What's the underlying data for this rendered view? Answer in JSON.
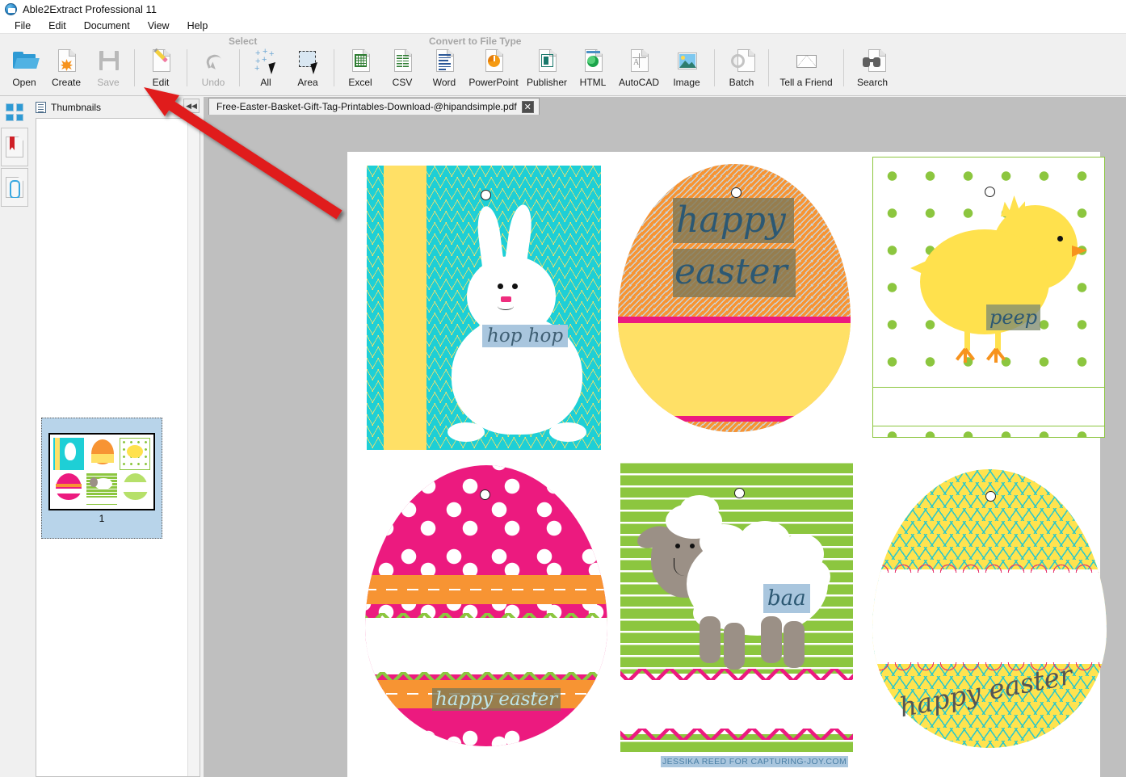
{
  "window": {
    "title": "Able2Extract Professional 11",
    "app_icon": "app-icon"
  },
  "menubar": {
    "items": [
      {
        "label": "File"
      },
      {
        "label": "Edit"
      },
      {
        "label": "Document"
      },
      {
        "label": "View"
      },
      {
        "label": "Help"
      }
    ]
  },
  "ribbon": {
    "group_captions": {
      "select": "Select",
      "convert": "Convert to File Type"
    },
    "tools": [
      {
        "label": "Open",
        "icon": "folder-open-icon",
        "disabled": false
      },
      {
        "label": "Create",
        "icon": "create-pdf-icon",
        "disabled": false
      },
      {
        "label": "Save",
        "icon": "floppy-save-icon",
        "disabled": true
      },
      {
        "label": "Edit",
        "icon": "pencil-edit-icon",
        "disabled": false
      },
      {
        "label": "Undo",
        "icon": "undo-arrow-icon",
        "disabled": true
      },
      {
        "label": "All",
        "icon": "select-all-icon",
        "disabled": false
      },
      {
        "label": "Area",
        "icon": "select-area-icon",
        "disabled": false
      },
      {
        "label": "Excel",
        "icon": "excel-icon",
        "disabled": false
      },
      {
        "label": "CSV",
        "icon": "csv-icon",
        "disabled": false
      },
      {
        "label": "Word",
        "icon": "word-icon",
        "disabled": false
      },
      {
        "label": "PowerPoint",
        "icon": "powerpoint-icon",
        "disabled": false
      },
      {
        "label": "Publisher",
        "icon": "publisher-icon",
        "disabled": false
      },
      {
        "label": "HTML",
        "icon": "html-icon",
        "disabled": false
      },
      {
        "label": "AutoCAD",
        "icon": "autocad-icon",
        "disabled": false
      },
      {
        "label": "Image",
        "icon": "image-icon",
        "disabled": false
      },
      {
        "label": "Batch",
        "icon": "batch-gear-icon",
        "disabled": false
      },
      {
        "label": "Tell a Friend",
        "icon": "envelope-icon",
        "disabled": false
      },
      {
        "label": "Search",
        "icon": "binoculars-icon",
        "disabled": false
      }
    ]
  },
  "rail": {
    "items": [
      {
        "name": "thumbnails-toggle",
        "icon": "grid-squares-icon"
      },
      {
        "name": "bookmarks-toggle",
        "icon": "bookmark-doc-icon"
      },
      {
        "name": "attachments-toggle",
        "icon": "paperclip-doc-icon"
      }
    ]
  },
  "thumbnails": {
    "header": "Thumbnails",
    "collapse_glyph": "◀◀",
    "scroll_up_glyph": "⌃",
    "pages": [
      {
        "number": "1",
        "selected": true
      }
    ]
  },
  "document_tab": {
    "filename": "Free-Easter-Basket-Gift-Tag-Printables-Download-@hipandsimple.pdf",
    "close_glyph": "✕"
  },
  "page_content": {
    "credit": "JESSIKA REED FOR CAPTURING-JOY.COM",
    "cards": [
      {
        "name": "bunny-tag",
        "text": "hop hop",
        "selected": true,
        "colors": {
          "bg": "#1ecfd6",
          "stripe": "#ffe066",
          "chevron": "#ffe066"
        }
      },
      {
        "name": "orange-egg-tag",
        "text_line1": "happy",
        "text_line2": "easter",
        "selected": true,
        "colors": {
          "body": "#f79433",
          "band": "#ec1a7f",
          "bottom": "#ffe066"
        }
      },
      {
        "name": "chick-tag",
        "text": "peep",
        "selected": true,
        "colors": {
          "dots": "#8cc63f",
          "chick": "#ffe14d",
          "beak": "#f7931e"
        }
      },
      {
        "name": "pink-egg-tag",
        "text": "happy easter",
        "selected": true,
        "colors": {
          "body": "#ec1a7f",
          "band": "#f79433",
          "zigzag": "#8cc63f"
        }
      },
      {
        "name": "sheep-tag",
        "text": "baa",
        "selected": true,
        "colors": {
          "bg": "#8cc63f",
          "sheep": "#9b9086",
          "zigzag": "#ec1a7f"
        }
      },
      {
        "name": "yellow-egg-tag",
        "text": "happy easter",
        "selected": false,
        "colors": {
          "body": "#ffe34f",
          "chevron": "#2fc8c8",
          "scallop": "#e8336b"
        }
      }
    ]
  },
  "annotation": {
    "arrow": {
      "name": "red-arrow-annotation",
      "points_to": "Edit",
      "color": "#e01b1b"
    }
  }
}
